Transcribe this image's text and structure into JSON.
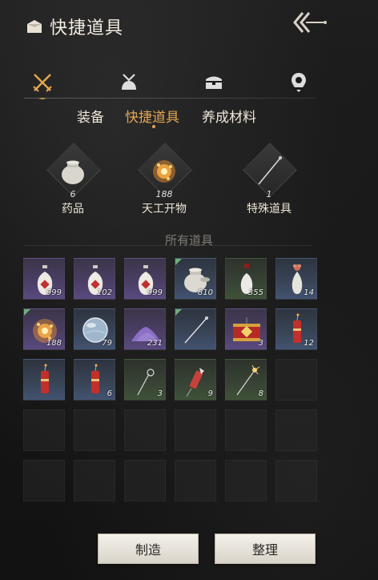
{
  "header": {
    "title": "快捷道具",
    "icon": "bag-icon",
    "back_icon": "back-arrow-icon"
  },
  "categories": [
    {
      "name": "crossed-swords-icon",
      "active": true
    },
    {
      "name": "pouch-icon",
      "active": false
    },
    {
      "name": "chest-icon",
      "active": false
    },
    {
      "name": "map-pin-icon",
      "active": false
    }
  ],
  "tabs": [
    {
      "label": "装备",
      "active": false
    },
    {
      "label": "快捷道具",
      "active": true
    },
    {
      "label": "养成材料",
      "active": false
    }
  ],
  "summary": [
    {
      "icon": "jar-icon",
      "count": "6",
      "label": "药品"
    },
    {
      "icon": "firework-burst-icon",
      "count": "188",
      "label": "天工开物"
    },
    {
      "icon": "needle-icon",
      "count": "1",
      "label": "特殊道具"
    }
  ],
  "section_title": "所有道具",
  "colors": {
    "accent": "#e3a554",
    "purple_slot": "#5a4a80",
    "blue_slot": "#425371",
    "green_slot": "#3f5238"
  },
  "items": [
    {
      "icon": "red-vase-icon",
      "qty": "999",
      "rarity": "purple",
      "new": false
    },
    {
      "icon": "red-vase-icon",
      "qty": "102",
      "rarity": "purple",
      "new": false
    },
    {
      "icon": "red-vase-icon",
      "qty": "999",
      "rarity": "purple",
      "new": false
    },
    {
      "icon": "jar-icon",
      "qty": "810",
      "rarity": "blue",
      "new": true
    },
    {
      "icon": "white-vase-icon",
      "qty": "355",
      "rarity": "green",
      "new": false
    },
    {
      "icon": "flower-vase-icon",
      "qty": "14",
      "rarity": "blue",
      "new": false
    },
    {
      "icon": "firework-burst-icon",
      "qty": "188",
      "rarity": "purple",
      "new": true
    },
    {
      "icon": "glass-orb-icon",
      "qty": "79",
      "rarity": "blue",
      "new": false
    },
    {
      "icon": "powder-pile-icon",
      "qty": "231",
      "rarity": "purple",
      "new": false
    },
    {
      "icon": "needle-icon",
      "qty": "",
      "rarity": "blue",
      "new": true
    },
    {
      "icon": "firecracker-box-icon",
      "qty": "3",
      "rarity": "purple",
      "new": false
    },
    {
      "icon": "firecracker-icon",
      "qty": "12",
      "rarity": "blue",
      "new": false
    },
    {
      "icon": "firecracker-icon",
      "qty": "",
      "rarity": "blue",
      "new": false
    },
    {
      "icon": "firecracker-icon",
      "qty": "6",
      "rarity": "blue",
      "new": false
    },
    {
      "icon": "sparkler-icon",
      "qty": "3",
      "rarity": "green",
      "new": false
    },
    {
      "icon": "rocket-icon",
      "qty": "9",
      "rarity": "green",
      "new": false
    },
    {
      "icon": "spark-stick-icon",
      "qty": "8",
      "rarity": "green",
      "new": false
    }
  ],
  "buttons": {
    "craft": "制造",
    "sort": "整理"
  }
}
